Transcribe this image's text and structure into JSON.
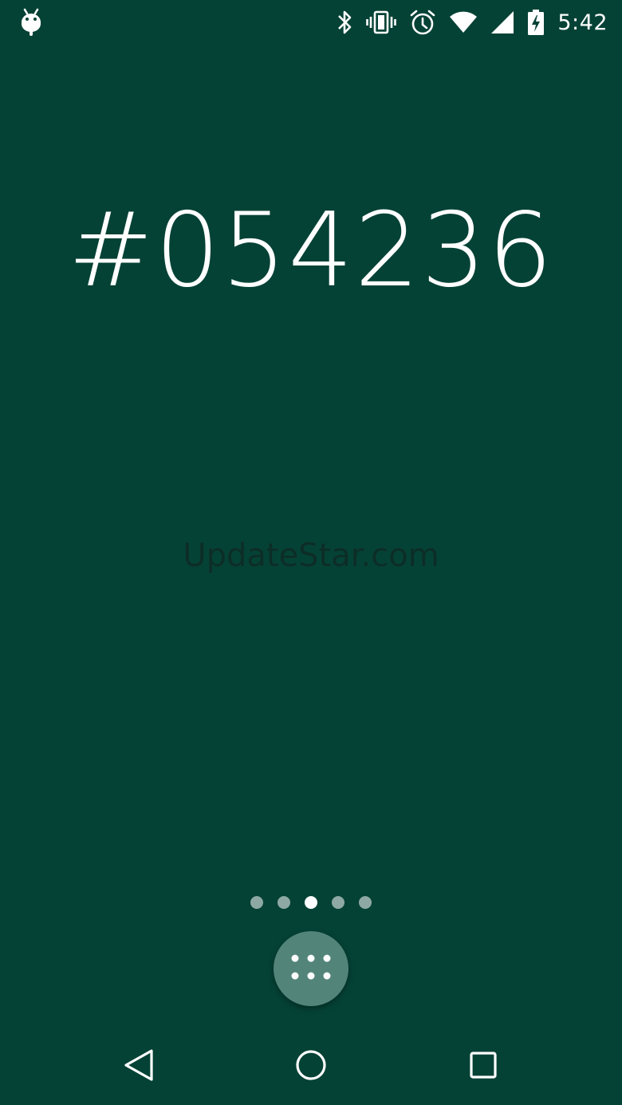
{
  "status_bar": {
    "time": "5:42",
    "icons": [
      "android-debug-icon",
      "bluetooth-icon",
      "vibrate-icon",
      "alarm-icon",
      "wifi-icon",
      "cell-signal-icon",
      "battery-charging-icon"
    ]
  },
  "wallpaper": {
    "color_code": "#054236",
    "background_color": "#054236"
  },
  "watermark": {
    "text": "UpdateStar.com"
  },
  "home_pages": {
    "count": 5,
    "active_index": 2
  },
  "navigation": {
    "buttons": [
      "back-icon",
      "home-icon",
      "recents-icon"
    ]
  },
  "colors": {
    "background": "#054236",
    "drawer_button": "#52847a",
    "foreground": "#ffffff"
  }
}
